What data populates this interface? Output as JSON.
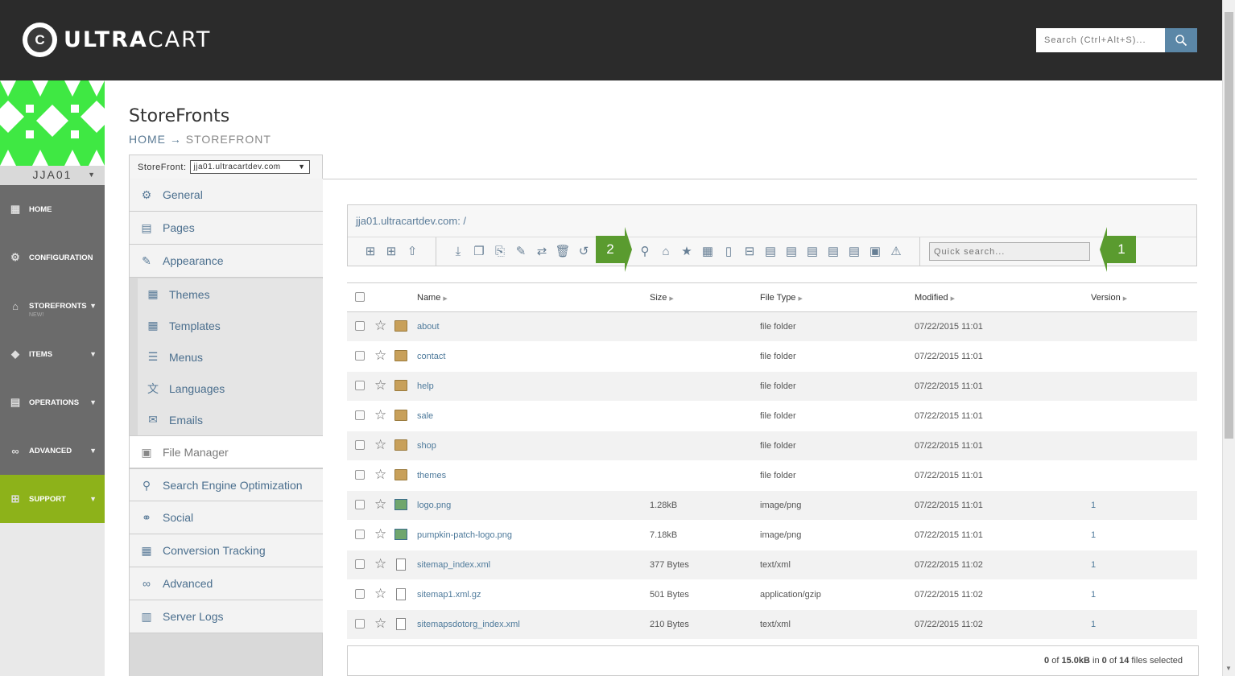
{
  "header": {
    "logo_mark": "C",
    "logo_bold": "ULTRA",
    "logo_light": "CART",
    "search_placeholder": "Search (Ctrl+Alt+S)..."
  },
  "account": {
    "name": "JJA01"
  },
  "nav": [
    {
      "label": "HOME",
      "icon": "home-icon",
      "has_arrow": false
    },
    {
      "label": "CONFIGURATION",
      "icon": "gear-icon",
      "has_arrow": false
    },
    {
      "label": "STOREFRONTS",
      "sub": "NEW!",
      "icon": "storefront-icon",
      "has_arrow": true
    },
    {
      "label": "ITEMS",
      "icon": "box-icon",
      "has_arrow": true
    },
    {
      "label": "OPERATIONS",
      "icon": "clipboard-icon",
      "has_arrow": true
    },
    {
      "label": "ADVANCED",
      "icon": "glasses-icon",
      "has_arrow": true
    },
    {
      "label": "SUPPORT",
      "icon": "plus-icon",
      "has_arrow": true
    }
  ],
  "page": {
    "title": "StoreFronts",
    "breadcrumb_home": "HOME",
    "breadcrumb_arrow": "→",
    "breadcrumb_current": "STOREFRONT"
  },
  "storefront_select": {
    "label": "StoreFront:",
    "value": "jja01.ultracartdev.com"
  },
  "submenu": {
    "general": "General",
    "pages": "Pages",
    "appearance": "Appearance",
    "themes": "Themes",
    "templates": "Templates",
    "menus": "Menus",
    "languages": "Languages",
    "emails": "Emails",
    "file_manager": "File Manager",
    "seo": "Search Engine Optimization",
    "social": "Social",
    "conversion": "Conversion Tracking",
    "advanced": "Advanced",
    "server_logs": "Server Logs"
  },
  "file_manager": {
    "path": "jja01.ultracartdev.com: /",
    "quick_search_placeholder": "Quick search...",
    "callout_1": "1",
    "callout_2": "2"
  },
  "table": {
    "headers": {
      "name": "Name",
      "size": "Size",
      "type": "File Type",
      "modified": "Modified",
      "version": "Version"
    },
    "rows": [
      {
        "name": "about",
        "size": "",
        "type": "file folder",
        "modified": "07/22/2015 11:01",
        "version": "",
        "kind": "folder"
      },
      {
        "name": "contact",
        "size": "",
        "type": "file folder",
        "modified": "07/22/2015 11:01",
        "version": "",
        "kind": "folder"
      },
      {
        "name": "help",
        "size": "",
        "type": "file folder",
        "modified": "07/22/2015 11:01",
        "version": "",
        "kind": "folder"
      },
      {
        "name": "sale",
        "size": "",
        "type": "file folder",
        "modified": "07/22/2015 11:01",
        "version": "",
        "kind": "folder"
      },
      {
        "name": "shop",
        "size": "",
        "type": "file folder",
        "modified": "07/22/2015 11:01",
        "version": "",
        "kind": "folder"
      },
      {
        "name": "themes",
        "size": "",
        "type": "file folder",
        "modified": "07/22/2015 11:01",
        "version": "",
        "kind": "folder"
      },
      {
        "name": "logo.png",
        "size": "1.28kB",
        "type": "image/png",
        "modified": "07/22/2015 11:01",
        "version": "1",
        "kind": "img"
      },
      {
        "name": "pumpkin-patch-logo.png",
        "size": "7.18kB",
        "type": "image/png",
        "modified": "07/22/2015 11:01",
        "version": "1",
        "kind": "img"
      },
      {
        "name": "sitemap_index.xml",
        "size": "377 Bytes",
        "type": "text/xml",
        "modified": "07/22/2015 11:02",
        "version": "1",
        "kind": "doc"
      },
      {
        "name": "sitemap1.xml.gz",
        "size": "501 Bytes",
        "type": "application/gzip",
        "modified": "07/22/2015 11:02",
        "version": "1",
        "kind": "doc"
      },
      {
        "name": "sitemapsdotorg_index.xml",
        "size": "210 Bytes",
        "type": "text/xml",
        "modified": "07/22/2015 11:02",
        "version": "1",
        "kind": "doc"
      }
    ]
  },
  "footer": {
    "selected_size": "0",
    "of_word": "of",
    "total_size": "15.0kB",
    "in_word": "in",
    "selected_files": "0",
    "of_word2": "of",
    "total_files": "14",
    "suffix": "files selected"
  }
}
